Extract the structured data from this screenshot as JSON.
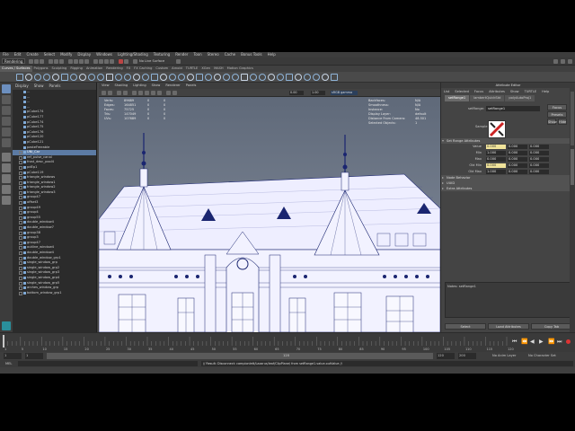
{
  "menubar": [
    "File",
    "Edit",
    "Create",
    "Select",
    "Modify",
    "Display",
    "Windows",
    "Lighting/Shading",
    "Texturing",
    "Render",
    "Toon",
    "Stereo",
    "Cache",
    "Bonus Tools",
    "Help"
  ],
  "statusline": {
    "mode": "Rendering",
    "no_live": "No Live Surface"
  },
  "shelf_tabs": [
    "Curves / Surfaces",
    "Polygons",
    "Sculpting",
    "Rigging",
    "Animation",
    "Rendering",
    "FX",
    "FX Caching",
    "Custom",
    "Arnold",
    "TURTLE",
    "XGen",
    "MASH",
    "Motion Graphics"
  ],
  "shelf_active": 0,
  "outliner": {
    "menu": [
      "Display",
      "Show",
      "Panels"
    ],
    "rows": [
      {
        "label": "...",
        "sel": false,
        "plus": false
      },
      {
        "label": "...",
        "sel": false,
        "plus": false
      },
      {
        "label": "...",
        "sel": false,
        "plus": false
      },
      {
        "label": "...",
        "sel": false,
        "plus": false
      },
      {
        "label": "pCube174",
        "sel": false,
        "plus": false
      },
      {
        "label": "pCube177",
        "sel": false,
        "plus": false
      },
      {
        "label": "pCube174",
        "sel": false,
        "plus": false
      },
      {
        "label": "pCube175",
        "sel": false,
        "plus": false
      },
      {
        "label": "pCube176",
        "sel": false,
        "plus": false
      },
      {
        "label": "pCube120",
        "sel": false,
        "plus": false
      },
      {
        "label": "pCube121",
        "sel": false,
        "plus": false
      },
      {
        "label": "pasteFreeable",
        "sel": false,
        "plus": false
      },
      {
        "label": "UNI_Car",
        "sel": true,
        "plus": true
      },
      {
        "label": "ref_pulse_canal",
        "sel": false,
        "plus": true
      },
      {
        "label": "frost_desc_pool4",
        "sel": false,
        "plus": true
      },
      {
        "label": "pdEp1",
        "sel": false,
        "plus": true
      },
      {
        "label": "pCube119",
        "sel": false,
        "plus": true
      },
      {
        "label": "triangle_windows",
        "sel": false,
        "plus": true
      },
      {
        "label": "triangle_window1",
        "sel": false,
        "plus": true
      },
      {
        "label": "triangle_window2",
        "sel": false,
        "plus": true
      },
      {
        "label": "triangle_window3",
        "sel": false,
        "plus": true
      },
      {
        "label": "group47",
        "sel": false,
        "plus": true
      },
      {
        "label": "offset3",
        "sel": false,
        "plus": true
      },
      {
        "label": "group49",
        "sel": false,
        "plus": true
      },
      {
        "label": "group4",
        "sel": false,
        "plus": true
      },
      {
        "label": "group55",
        "sel": false,
        "plus": true
      },
      {
        "label": "double_window4",
        "sel": false,
        "plus": true
      },
      {
        "label": "double_window7",
        "sel": false,
        "plus": true
      },
      {
        "label": "group38",
        "sel": false,
        "plus": true
      },
      {
        "label": "group3",
        "sel": false,
        "plus": true
      },
      {
        "label": "group47",
        "sel": false,
        "plus": true
      },
      {
        "label": "outline_window4",
        "sel": false,
        "plus": true
      },
      {
        "label": "double_window4",
        "sel": false,
        "plus": true
      },
      {
        "label": "double_window_grp1",
        "sel": false,
        "plus": true
      },
      {
        "label": "single_window_grp",
        "sel": false,
        "plus": true
      },
      {
        "label": "single_window_grp2",
        "sel": false,
        "plus": true
      },
      {
        "label": "single_window_grp3",
        "sel": false,
        "plus": true
      },
      {
        "label": "single_window_grp4",
        "sel": false,
        "plus": true
      },
      {
        "label": "single_window_grp5",
        "sel": false,
        "plus": true
      },
      {
        "label": "arches_window_grp",
        "sel": false,
        "plus": true
      },
      {
        "label": "bottom_window_grp1",
        "sel": false,
        "plus": true
      }
    ]
  },
  "viewport": {
    "menu": [
      "View",
      "Shading",
      "Lighting",
      "Show",
      "Renderer",
      "Panels"
    ],
    "field1": "0.00",
    "field2": "1.00",
    "colorspace": "sRGB gamma",
    "hud_left": [
      {
        "label": "Verts:",
        "v1": "89689",
        "v2": "0",
        "v3": "0"
      },
      {
        "label": "Edges:",
        "v1": "164851",
        "v2": "0",
        "v3": "0"
      },
      {
        "label": "Faces:",
        "v1": "75725",
        "v2": "0",
        "v3": "0"
      },
      {
        "label": "Tris:",
        "v1": "147049",
        "v2": "0",
        "v3": "0"
      },
      {
        "label": "UVs:",
        "v1": "107689",
        "v2": "0",
        "v3": "0"
      }
    ],
    "hud_right": [
      {
        "label": "Backfaces:",
        "value": "N/A"
      },
      {
        "label": "Smoothness:",
        "value": "N/A"
      },
      {
        "label": "Instance:",
        "value": "No"
      },
      {
        "label": "Display Layer:",
        "value": "default"
      },
      {
        "label": "Distance From Camera:",
        "value": "48.501"
      },
      {
        "label": "Selected Objects:",
        "value": "1"
      }
    ]
  },
  "attribute_editor": {
    "title": "Attribute Editor",
    "menu": [
      "List",
      "Selected",
      "Focus",
      "Attributes",
      "Show",
      "TURTLE",
      "Help"
    ],
    "tabs": [
      "setRange1",
      "lambertQuickStd",
      "polyAutoProj1"
    ],
    "node_label": "setRange:",
    "node_value": "setRange1",
    "focus": "Focus",
    "presets": "Presets",
    "show": "Show",
    "hide": "Hide",
    "sample": "Sample",
    "sections": [
      {
        "label": "Set Range Attributes",
        "open": true
      },
      {
        "label": "Node Behavior",
        "open": false
      },
      {
        "label": "UUID",
        "open": false
      },
      {
        "label": "Extra Attributes",
        "open": false
      }
    ],
    "fields": [
      {
        "label": "Value",
        "a": "0.000",
        "b": "0.000",
        "c": "0.000",
        "hl": true
      },
      {
        "label": "Min",
        "a": "1.000",
        "b": "0.000",
        "c": "0.000",
        "hl": false
      },
      {
        "label": "Max",
        "a": "0.000",
        "b": "0.000",
        "c": "0.000",
        "hl": false
      },
      {
        "label": "Old Min",
        "a": "0.000",
        "b": "0.000",
        "c": "0.000",
        "hl": true
      },
      {
        "label": "Old Max",
        "a": "1.000",
        "b": "0.000",
        "c": "0.000",
        "hl": false
      }
    ],
    "notes": "Notes: setRange1",
    "buttons": [
      "Select",
      "Load Attributes",
      "Copy Tab"
    ]
  },
  "timeline": {
    "ticks": [
      "1",
      "5",
      "10",
      "15",
      "20",
      "25",
      "30",
      "35",
      "40",
      "45",
      "50",
      "55",
      "60",
      "65",
      "70",
      "75",
      "80",
      "85",
      "90",
      "95",
      "100",
      "105",
      "110",
      "115",
      "120"
    ],
    "current": "1"
  },
  "range": {
    "start": "1",
    "inner_start": "1",
    "inner_end": "120",
    "end": "120",
    "end2": "200",
    "anim_layer": "No Anim Layer",
    "char_set": "No Character Set"
  },
  "cmdline": {
    "label": "MEL",
    "result": "// Result: Disconnect: campionlett/Lazarus/leaf/ClipPlane/ from setRange1.value.outValue //"
  },
  "colors": {
    "accent": "#5c7ba4",
    "highlight_field": "#f0e39a",
    "wire": "#1a2570",
    "paper": "#f2f2ff"
  }
}
